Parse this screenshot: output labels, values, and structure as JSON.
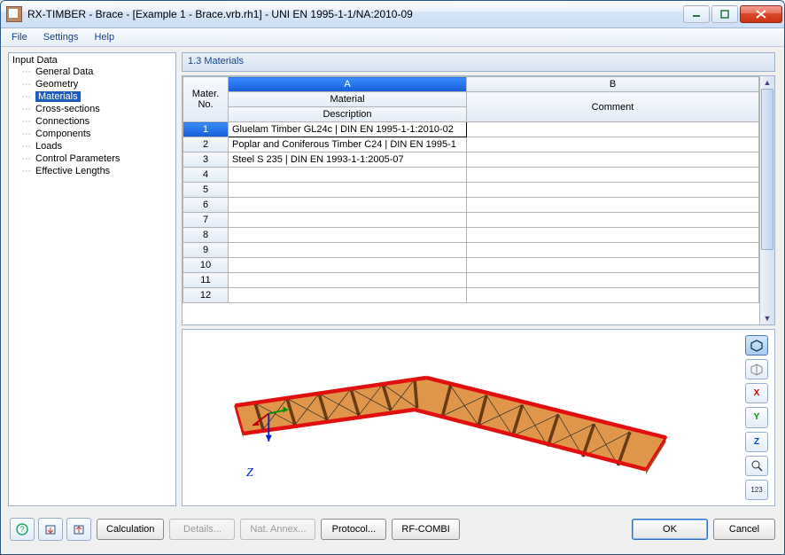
{
  "window": {
    "title": "RX-TIMBER - Brace - [Example 1 - Brace.vrb.rh1] - UNI EN 1995-1-1/NA:2010-09"
  },
  "menu": {
    "items": [
      "File",
      "Settings",
      "Help"
    ]
  },
  "nav": {
    "title": "Input Data",
    "items": [
      {
        "label": "General Data"
      },
      {
        "label": "Geometry"
      },
      {
        "label": "Materials",
        "selected": true
      },
      {
        "label": "Cross-sections"
      },
      {
        "label": "Connections"
      },
      {
        "label": "Components"
      },
      {
        "label": "Loads"
      },
      {
        "label": "Control Parameters"
      },
      {
        "label": "Effective Lengths"
      }
    ]
  },
  "panel": {
    "title": "1.3 Materials",
    "columns": {
      "no_top": "Mater.",
      "no_bottom": "No.",
      "a_letter": "A",
      "a_top": "Material",
      "a_bottom": "Description",
      "b_letter": "B",
      "b_bottom": "Comment"
    },
    "rows": [
      {
        "n": "1",
        "desc": "Gluelam Timber GL24c | DIN EN 1995-1-1:2010-02",
        "comment": "",
        "sel": true
      },
      {
        "n": "2",
        "desc": "Poplar and Coniferous Timber C24 | DIN EN 1995-1",
        "comment": ""
      },
      {
        "n": "3",
        "desc": "Steel S 235 | DIN EN 1993-1-1:2005-07",
        "comment": ""
      },
      {
        "n": "4",
        "desc": "",
        "comment": ""
      },
      {
        "n": "5",
        "desc": "",
        "comment": ""
      },
      {
        "n": "6",
        "desc": "",
        "comment": ""
      },
      {
        "n": "7",
        "desc": "",
        "comment": ""
      },
      {
        "n": "8",
        "desc": "",
        "comment": ""
      },
      {
        "n": "9",
        "desc": "",
        "comment": ""
      },
      {
        "n": "10",
        "desc": "",
        "comment": ""
      },
      {
        "n": "11",
        "desc": "",
        "comment": ""
      },
      {
        "n": "12",
        "desc": "",
        "comment": ""
      }
    ]
  },
  "viewer": {
    "axis_z": "Z"
  },
  "buttons": {
    "calculation": "Calculation",
    "details": "Details...",
    "nat_annex": "Nat. Annex...",
    "protocol": "Protocol...",
    "rf_combi": "RF-COMBI",
    "ok": "OK",
    "cancel": "Cancel"
  },
  "colors": {
    "highlight": "#1f5bbd"
  }
}
